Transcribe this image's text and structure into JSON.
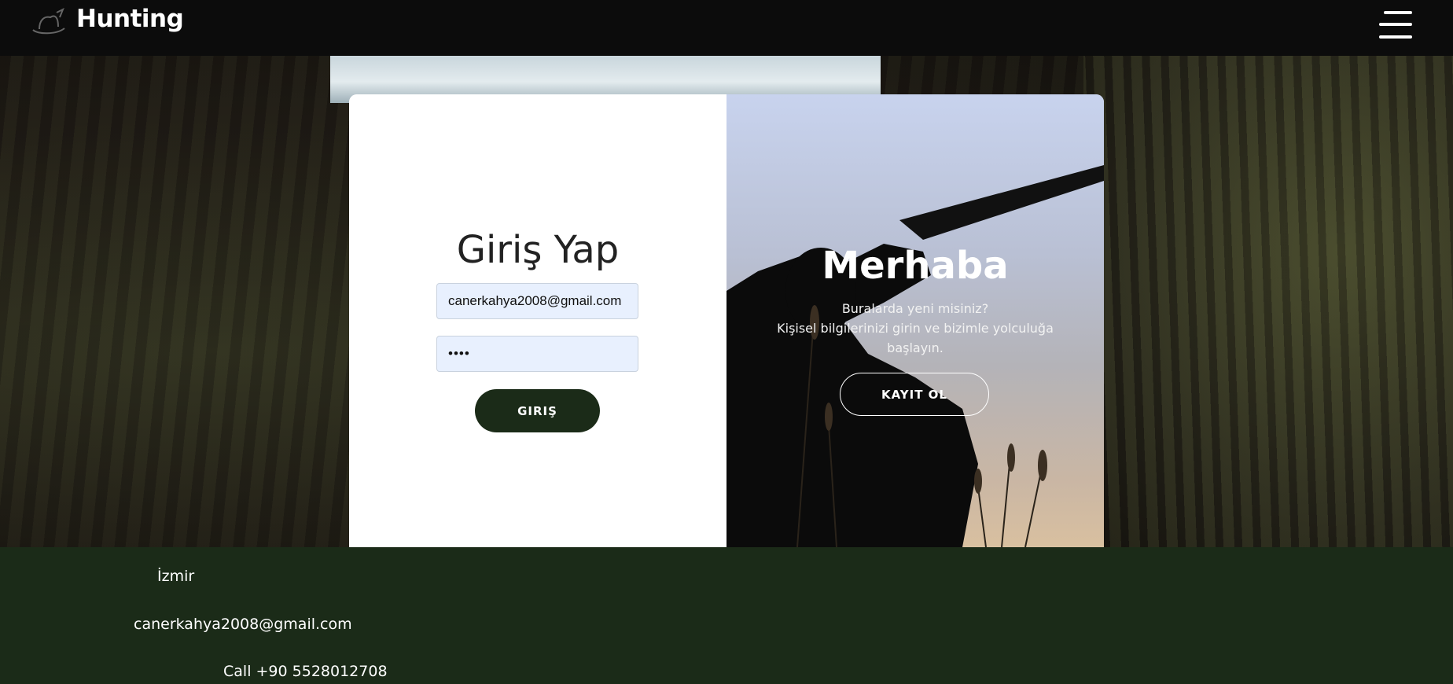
{
  "header": {
    "brand": "Hunting",
    "logo_icon": "hat-icon",
    "menu_icon": "hamburger-menu-icon"
  },
  "login": {
    "title": "Giriş Yap",
    "email_value": "canerkahya2008@gmail.com",
    "password_value": "••••",
    "submit_label": "GIRIŞ"
  },
  "welcome": {
    "title": "Merhaba",
    "line1": "Buralarda yeni misiniz?",
    "line2": "Kişisel bilgilerinizi girin ve bizimle yolculuğa başlayın.",
    "register_label": "KAYIT OL"
  },
  "footer": {
    "city": "İzmir",
    "email": "canerkahya2008@gmail.com",
    "phone": "Call +90 5528012708"
  },
  "colors": {
    "navbar": "#0c0c0c",
    "footer": "#1b2b18",
    "login_button": "#1b2b18",
    "input_bg": "#e8f0fe"
  }
}
